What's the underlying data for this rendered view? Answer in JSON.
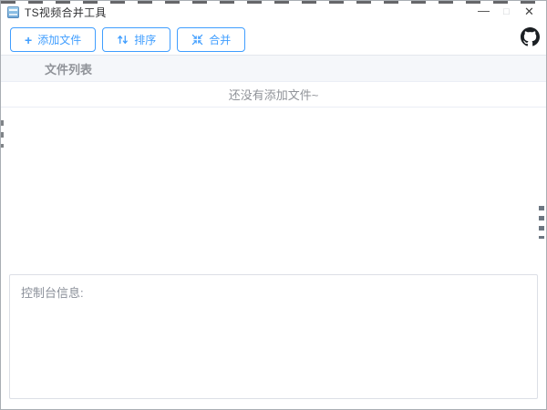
{
  "window": {
    "title": "TS视频合并工具",
    "minimize_glyph": "—",
    "maximize_glyph": "□",
    "close_glyph": "✕"
  },
  "toolbar": {
    "add_icon_glyph": "+",
    "add_label": "添加文件",
    "sort_label": "排序",
    "merge_label": "合并"
  },
  "icons": {
    "app": "app-logo-icon",
    "add": "plus-icon",
    "sort": "sort-arrows-icon",
    "merge": "compress-inward-arrows-icon",
    "github": "github-octocat-icon",
    "minimize": "minimize-icon",
    "maximize": "maximize-icon",
    "close": "close-icon"
  },
  "file_table": {
    "header_label": "文件列表",
    "empty_text": "还没有添加文件~",
    "rows": []
  },
  "console_panel": {
    "label": "控制台信息:"
  },
  "colors": {
    "primary_blue": "#409eff",
    "muted_text": "#909399",
    "table_header_bg": "#f5f7fa",
    "border_light": "#ebeef5",
    "console_border": "#dcdfe6",
    "github_black": "#1b1f23",
    "title_text": "#303133"
  }
}
